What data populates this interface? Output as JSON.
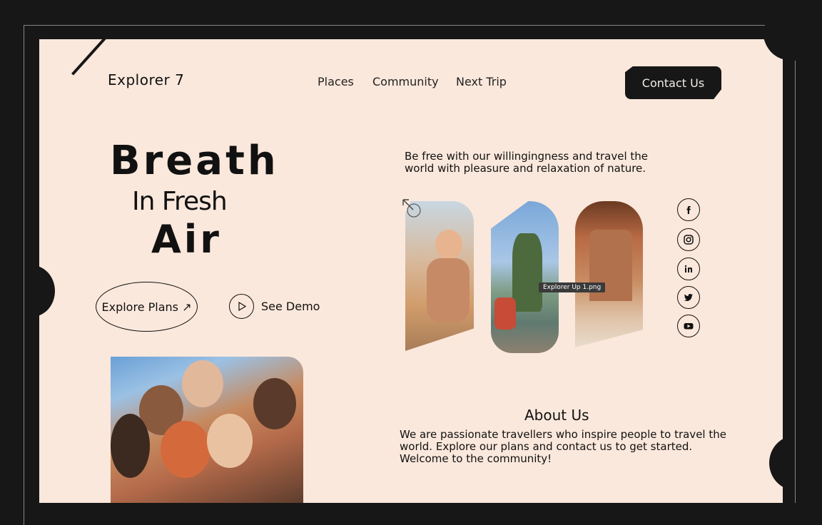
{
  "header": {
    "brand": "Explorer 7",
    "nav": [
      "Places",
      "Community",
      "Next Trip"
    ],
    "contact_label": "Contact Us"
  },
  "hero": {
    "line1": "Breath",
    "line2": "In Fresh",
    "line3": "Air",
    "explore_label": "Explore Plans ↗",
    "demo_label": "See Demo"
  },
  "tagline": "Be free with our willingingness and travel the world with pleasure and relaxation of nature.",
  "tooltip": "Explorer Up 1.png",
  "social_icons": [
    "facebook-icon",
    "instagram-icon",
    "linkedin-icon",
    "twitter-icon",
    "youtube-icon"
  ],
  "about": {
    "title": "About Us",
    "text": "We are passionate travellers who inspire people to travel the world. Explore our plans and contact us to get started. Welcome to the community!"
  },
  "colors": {
    "background": "#171717",
    "page": "#fbe8dc",
    "accent": "#171717"
  }
}
